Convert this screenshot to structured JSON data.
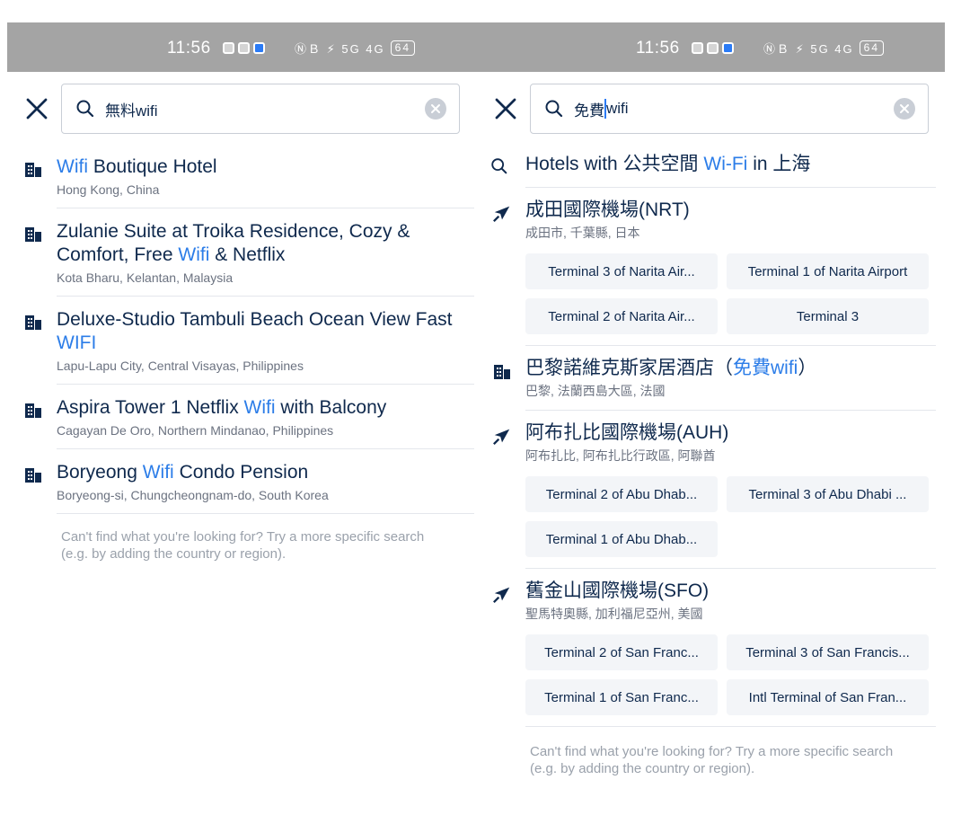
{
  "left": {
    "status": {
      "time": "11:56",
      "icons": "ⓃＢ ⚡ 5G 4G",
      "battery": "64"
    },
    "search": {
      "query": "無料wifi"
    },
    "results": [
      {
        "pre": "",
        "hl": "Wifi",
        "post": " Boutique Hotel",
        "sub": "Hong Kong, China"
      },
      {
        "pre": "Zulanie Suite at Troika Residence, Cozy & Comfort, Free ",
        "hl": "Wifi",
        "post": " & Netflix",
        "sub": "Kota Bharu, Kelantan, Malaysia"
      },
      {
        "pre": "Deluxe-Studio Tambuli Beach Ocean View Fast ",
        "hl": "WIFI",
        "post": "",
        "sub": "Lapu-Lapu City, Central Visayas, Philippines"
      },
      {
        "pre": "Aspira Tower 1 Netflix ",
        "hl": "Wifi",
        "post": " with Balcony",
        "sub": "Cagayan De Oro, Northern Mindanao, Philippines"
      },
      {
        "pre": "Boryeong ",
        "hl": "Wifi",
        "post": " Condo Pension",
        "sub": "Boryeong-si, Chungcheongnam-do, South Korea"
      }
    ],
    "hint": "Can't find what you're looking for? Try a more specific search (e.g. by adding the country or region)."
  },
  "right": {
    "status": {
      "time": "11:56",
      "icons": "ⓃＢ ⚡ 5G 4G",
      "battery": "64"
    },
    "search": {
      "query_before": "免費",
      "query_after": "wifi"
    },
    "top": {
      "pre": "Hotels with 公共空間 ",
      "hl": "Wi-Fi",
      "post": " in 上海"
    },
    "airport1": {
      "title": "成田國際機場(NRT)",
      "sub": "成田市, 千葉縣, 日本",
      "terminals": [
        "Terminal 3 of Narita Air...",
        "Terminal 1 of Narita Airport",
        "Terminal 2 of Narita Air...",
        "Terminal 3"
      ]
    },
    "hotel": {
      "pre": "巴黎諾維克斯家居酒店（",
      "hl": "免費wifi",
      "post": "）",
      "sub": "巴黎, 法蘭西島大區, 法國"
    },
    "airport2": {
      "title": "阿布扎比國際機場(AUH)",
      "sub": "阿布扎比, 阿布扎比行政區, 阿聯酋",
      "terminals": [
        "Terminal 2 of Abu Dhab...",
        "Terminal 3 of Abu Dhabi ...",
        "Terminal 1 of Abu Dhab..."
      ]
    },
    "airport3": {
      "title": "舊金山國際機場(SFO)",
      "sub": "聖馬特奧縣, 加利福尼亞州, 美國",
      "terminals": [
        "Terminal 2 of San Franc...",
        "Terminal 3 of San Francis...",
        "Terminal 1 of San Franc...",
        "Intl Terminal of San Fran..."
      ]
    },
    "hint": "Can't find what you're looking for? Try a more specific search (e.g. by adding the country or region)."
  },
  "colors": {
    "highlight": "#2c7de8",
    "text": "#0f294d",
    "status_bg": "#a4a4a4",
    "chip_bg": "#f3f5f8"
  }
}
